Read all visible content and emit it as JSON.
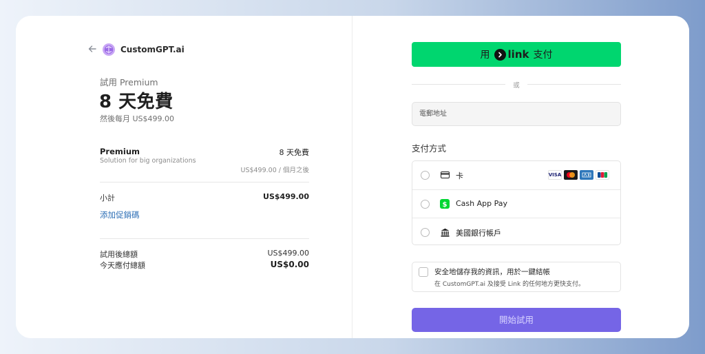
{
  "brand": {
    "name": "CustomGPT.ai"
  },
  "trial": {
    "label": "試用 Premium",
    "headline": "8 天免費",
    "then": "然後每月 US$499.00"
  },
  "line_item": {
    "name": "Premium",
    "description": "Solution for big organizations",
    "trial_text": "8 天免費",
    "price_note": "US$499.00 / 個月之後"
  },
  "subtotal": {
    "label": "小計",
    "value": "US$499.00"
  },
  "promo": {
    "label": "添加促銷碼"
  },
  "totals": {
    "after_trial_label": "試用後總額",
    "after_trial_value": "US$499.00",
    "due_today_label": "今天應付總額",
    "due_today_value": "US$0.00"
  },
  "link_button": {
    "prefix": "用",
    "brand": "link",
    "suffix": "支付",
    "color": "#00d66f"
  },
  "or_text": "或",
  "email": {
    "placeholder": "電郵地址"
  },
  "payment_methods": {
    "title": "支付方式",
    "options": [
      {
        "label": "卡",
        "icon": "card-icon",
        "brands": [
          "VISA",
          "MC",
          "AMEX",
          "JCB"
        ]
      },
      {
        "label": "Cash App Pay",
        "icon": "cash-app-icon"
      },
      {
        "label": "美國銀行帳戶",
        "icon": "bank-icon"
      }
    ]
  },
  "save_info": {
    "main": "安全地儲存我的資訊，用於一鍵結帳",
    "sub": "在 CustomGPT.ai 及接受 Link 的任何地方更快支付。"
  },
  "start_button": {
    "label": "開始試用",
    "color": "#7565e6"
  }
}
